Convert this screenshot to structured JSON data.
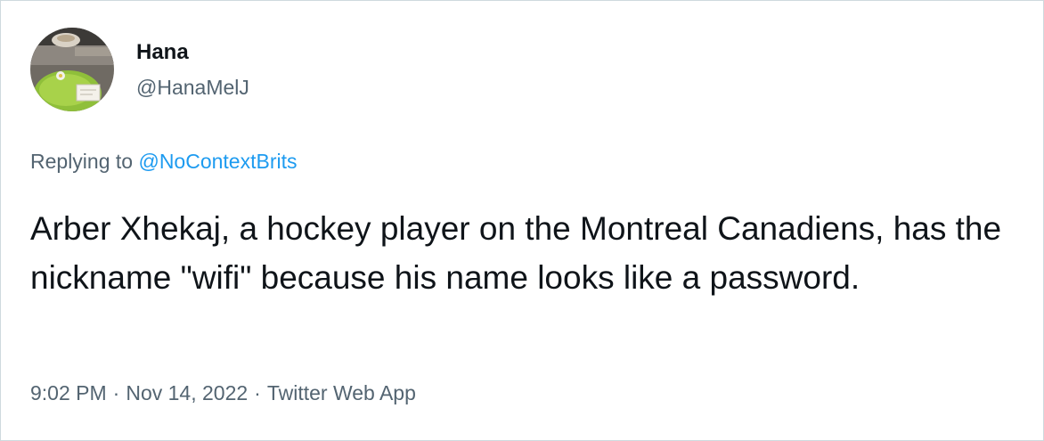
{
  "author": {
    "display_name": "Hana",
    "handle": "@HanaMelJ"
  },
  "reply": {
    "prefix": "Replying to",
    "mention": "@NoContextBrits"
  },
  "tweet": {
    "text": "Arber Xhekaj, a hockey player on the Montreal Canadiens, has the nickname \"wifi\" because his name looks like a password."
  },
  "meta": {
    "time": "9:02 PM",
    "separator": "·",
    "date": "Nov 14, 2022",
    "source": "Twitter Web App"
  },
  "colors": {
    "text_primary": "#0f1419",
    "text_secondary": "#536471",
    "link": "#1d9bf0",
    "border": "#cfd9de"
  }
}
